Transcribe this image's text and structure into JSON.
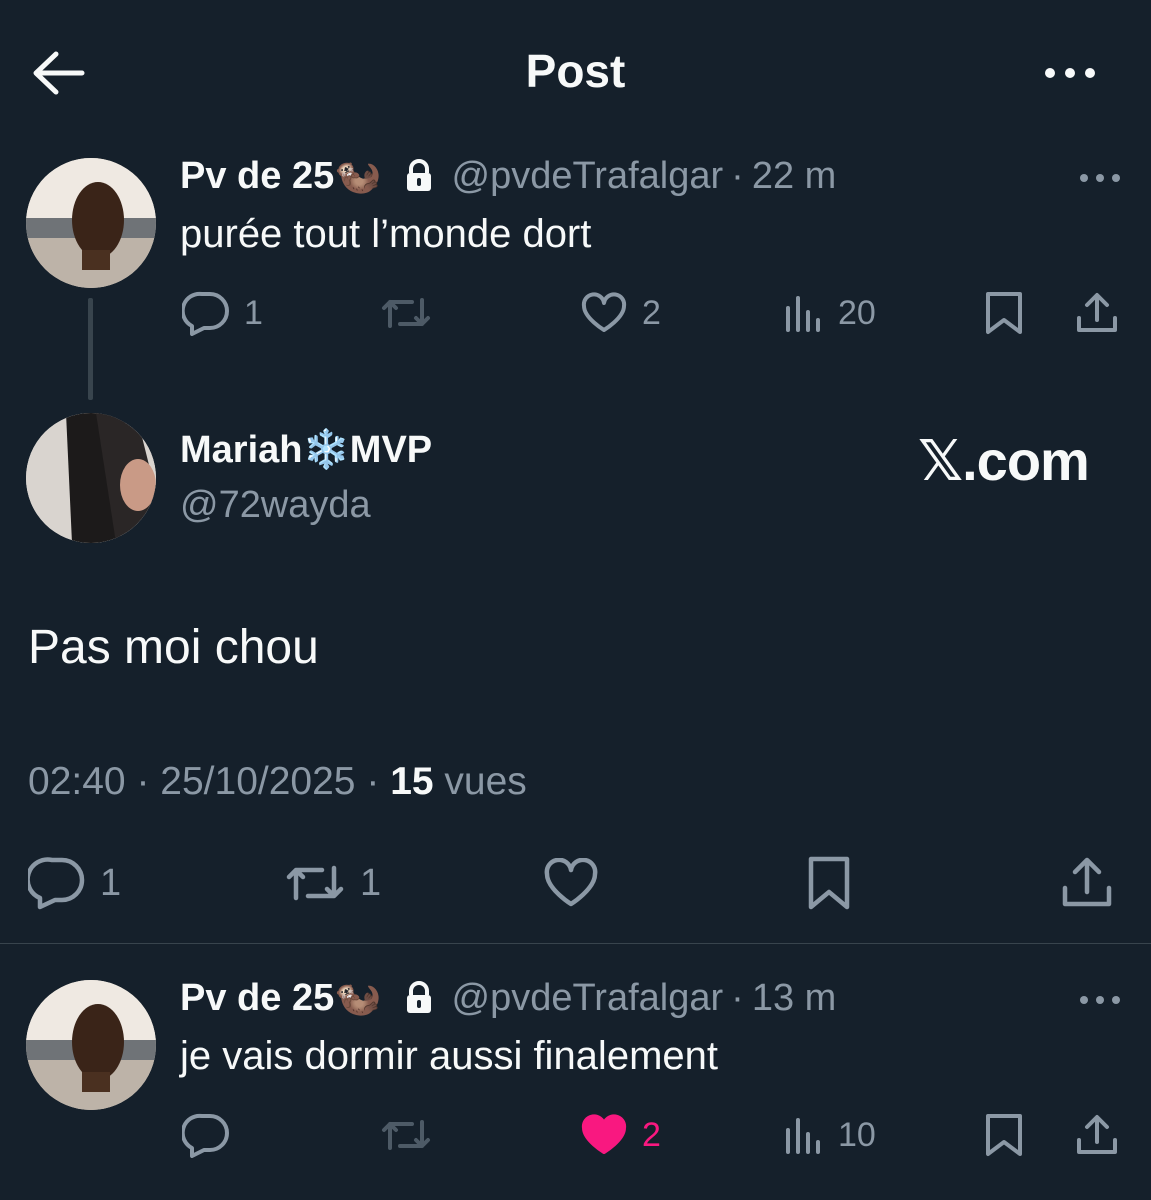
{
  "header": {
    "title": "Post"
  },
  "parent_tweet": {
    "name": "Pv de 25🦦",
    "handle": "@pvdeTrafalgar",
    "separator": "·",
    "time": "22 m",
    "text": "purée tout l’monde dort",
    "replies": "1",
    "retweets": "",
    "likes": "2",
    "views": "20"
  },
  "main_tweet": {
    "name": "Mariah❄️MVP",
    "handle": "@72wayda",
    "watermark": "𝕏.com",
    "text": "Pas moi chou",
    "time": "02:40",
    "date": "25/10/2025",
    "sep1": "·",
    "sep2": "·",
    "views_count": "15",
    "views_label": "vues",
    "replies": "1",
    "retweets": "1",
    "likes": ""
  },
  "reply_tweet": {
    "name": "Pv de 25🦦",
    "handle": "@pvdeTrafalgar",
    "separator": "·",
    "time": "13 m",
    "text": "je vais dormir aussi finalement",
    "replies": "",
    "retweets": "",
    "likes": "2",
    "views": "10",
    "liked": true,
    "like_color": "#f91880"
  },
  "icons": [
    "back-arrow-icon",
    "more-icon",
    "lock-icon",
    "reply-icon",
    "retweet-icon",
    "like-icon",
    "views-icon",
    "bookmark-icon",
    "share-icon"
  ]
}
